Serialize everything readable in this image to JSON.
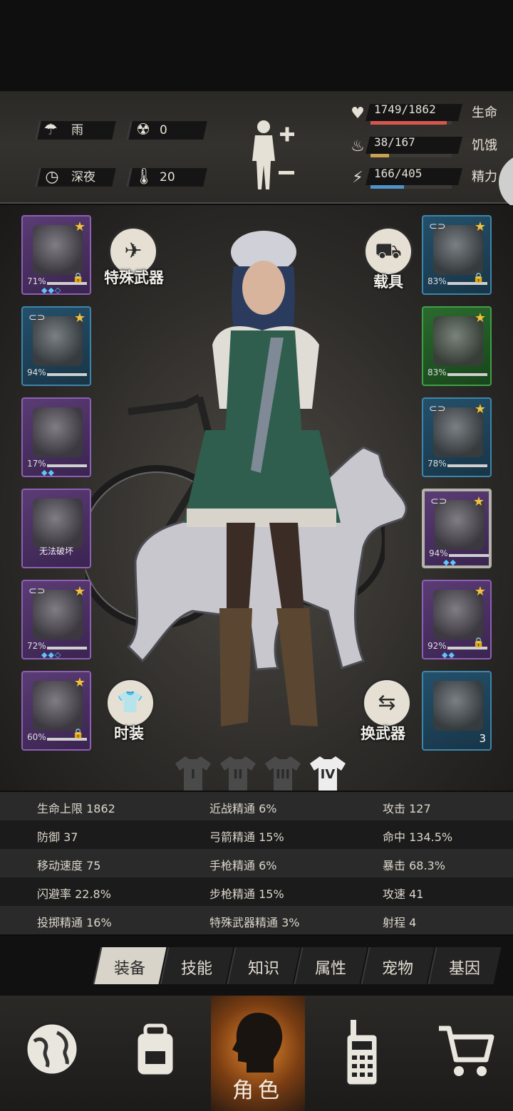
{
  "header": {
    "weather": {
      "icon": "rain-cloud-icon",
      "label": "雨"
    },
    "radiation": {
      "icon": "radiation-icon",
      "value": "0"
    },
    "time": {
      "icon": "clock-icon",
      "label": "深夜"
    },
    "temperature": {
      "icon": "thermometer-icon",
      "value": "20"
    },
    "body_icon": "body-adjust-icon",
    "stats": [
      {
        "name": "生命",
        "value": "1749/1862",
        "fraction": 0.939,
        "color": "#d7574f",
        "icon": "heart-icon"
      },
      {
        "name": "饥饿",
        "value": "38/167",
        "fraction": 0.228,
        "color": "#c9a250",
        "icon": "stomach-icon"
      },
      {
        "name": "精力",
        "value": "166/405",
        "fraction": 0.41,
        "color": "#4f92c9",
        "icon": "lightning-icon"
      }
    ]
  },
  "left_slots": [
    {
      "name": "helmet",
      "rarity": "purple",
      "percent": "71%",
      "star": true,
      "lock": true,
      "gems": "◆◆◇",
      "link": false
    },
    {
      "name": "shirt",
      "rarity": "blue",
      "percent": "94%",
      "star": true,
      "lock": false,
      "gems": "",
      "link": true
    },
    {
      "name": "jacket",
      "rarity": "purple",
      "percent": "17%",
      "star": false,
      "lock": false,
      "gems": "◆◆",
      "link": false
    },
    {
      "name": "backpack",
      "rarity": "purple",
      "percent": "",
      "star": false,
      "lock": false,
      "gems": "",
      "link": false,
      "status": "无法破坏"
    },
    {
      "name": "pants",
      "rarity": "purple",
      "percent": "72%",
      "star": true,
      "lock": false,
      "gems": "◆◆◇",
      "link": true
    },
    {
      "name": "boots",
      "rarity": "purple",
      "percent": "60%",
      "star": true,
      "lock": true,
      "gems": "",
      "link": false
    }
  ],
  "right_slots": [
    {
      "name": "glasses",
      "rarity": "blue",
      "percent": "83%",
      "star": true,
      "lock": true,
      "gems": "",
      "link": true
    },
    {
      "name": "mask",
      "rarity": "green",
      "percent": "83%",
      "star": true,
      "lock": false,
      "gems": "",
      "link": false
    },
    {
      "name": "vest",
      "rarity": "blue",
      "percent": "78%",
      "star": true,
      "lock": false,
      "gems": "",
      "link": true
    },
    {
      "name": "bow",
      "rarity": "purple",
      "percent": "94%",
      "star": true,
      "lock": false,
      "gems": "◆◆",
      "link": true,
      "selected": true
    },
    {
      "name": "machete",
      "rarity": "purple",
      "percent": "92%",
      "star": true,
      "lock": true,
      "gems": "◆◆",
      "link": false
    },
    {
      "name": "dynamite",
      "rarity": "blue",
      "percent": "",
      "star": false,
      "lock": false,
      "gems": "",
      "link": false,
      "count": "3"
    }
  ],
  "buttons": {
    "special_weapon": "特殊武器",
    "vehicle": "载具",
    "fashion": "时装",
    "swap_weapon": "换武器"
  },
  "outfit_tabs": [
    "I",
    "II",
    "III",
    "IV"
  ],
  "outfit_active": 3,
  "stats_table": [
    [
      "生命上限 1862",
      "近战精通 6%",
      "攻击 127"
    ],
    [
      "防御 37",
      "弓箭精通 15%",
      "命中 134.5%"
    ],
    [
      "移动速度 75",
      "手枪精通 6%",
      "暴击 68.3%"
    ],
    [
      "闪避率 22.8%",
      "步枪精通 15%",
      "攻速 41"
    ],
    [
      "投掷精通 16%",
      "特殊武器精通 3%",
      "射程 4"
    ]
  ],
  "tabs": [
    "装备",
    "技能",
    "知识",
    "属性",
    "宠物",
    "基因"
  ],
  "active_tab": 0,
  "nav": [
    {
      "icon": "globe-icon",
      "label": ""
    },
    {
      "icon": "backpack-icon",
      "label": ""
    },
    {
      "icon": "character-head-icon",
      "label": "角色"
    },
    {
      "icon": "radio-icon",
      "label": ""
    },
    {
      "icon": "shopping-cart-icon",
      "label": ""
    }
  ]
}
